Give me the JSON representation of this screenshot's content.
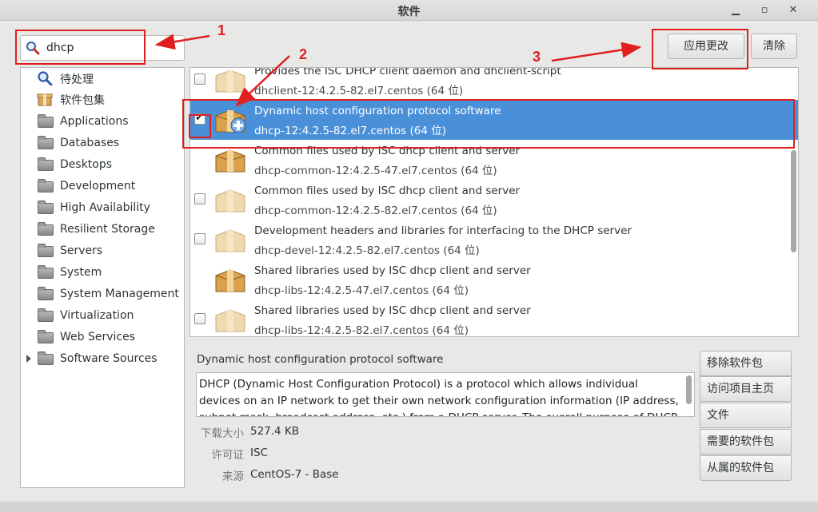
{
  "window": {
    "title": "软件"
  },
  "search": {
    "value": "dhcp"
  },
  "toolbar": {
    "apply_label": "应用更改",
    "clear_label": "清除"
  },
  "sidebar": {
    "top_items": [
      {
        "label": "待处理",
        "icon": "magnifier-icon"
      },
      {
        "label": "软件包集",
        "icon": "package-group-icon"
      }
    ],
    "groups": [
      {
        "label": "Applications"
      },
      {
        "label": "Databases"
      },
      {
        "label": "Desktops"
      },
      {
        "label": "Development"
      },
      {
        "label": "High Availability"
      },
      {
        "label": "Resilient Storage"
      },
      {
        "label": "Servers"
      },
      {
        "label": "System"
      },
      {
        "label": "System Management"
      },
      {
        "label": "Virtualization"
      },
      {
        "label": "Web Services"
      },
      {
        "label": "Software Sources"
      }
    ]
  },
  "packages": [
    {
      "summary": "Provides the ISC DHCP client daemon and dhclient-script",
      "name": "dhclient-12:4.2.5-82.el7.centos (64 位)",
      "checked": false,
      "selected": false
    },
    {
      "summary": "Dynamic host configuration protocol software",
      "name": "dhcp-12:4.2.5-82.el7.centos (64 位)",
      "checked": true,
      "selected": true
    },
    {
      "summary": "Common files used by ISC dhcp client and server",
      "name": "dhcp-common-12:4.2.5-47.el7.centos (64 位)",
      "checked": false,
      "selected": false
    },
    {
      "summary": "Common files used by ISC dhcp client and server",
      "name": "dhcp-common-12:4.2.5-82.el7.centos (64 位)",
      "checked": false,
      "selected": false
    },
    {
      "summary": "Development headers and libraries for interfacing to the DHCP server",
      "name": "dhcp-devel-12:4.2.5-82.el7.centos (64 位)",
      "checked": false,
      "selected": false
    },
    {
      "summary": "Shared libraries used by ISC dhcp client and server",
      "name": "dhcp-libs-12:4.2.5-47.el7.centos (64 位)",
      "checked": false,
      "selected": false
    },
    {
      "summary": "Shared libraries used by ISC dhcp client and server",
      "name": "dhcp-libs-12:4.2.5-82.el7.centos (64 位)",
      "checked": false,
      "selected": false
    }
  ],
  "details": {
    "title": "Dynamic host configuration protocol software",
    "description": "DHCP (Dynamic Host Configuration Protocol) is a protocol which allows individual devices on an IP network to get their own network configuration information (IP address, subnet mask, broadcast address, etc.) from a DHCP server. The overall purpose of DHCP is",
    "download_size_label": "下载大小",
    "download_size": "527.4 KB",
    "license_label": "许可证",
    "license": "ISC",
    "source_label": "来源",
    "source": "CentOS-7 - Base"
  },
  "actions": {
    "remove": "移除软件包",
    "homepage": "访问项目主页",
    "files": "文件",
    "requires": "需要的软件包",
    "depends": "从属的软件包"
  },
  "annotations": {
    "n1": "1",
    "n2": "2",
    "n3": "3"
  },
  "colors": {
    "selection": "#4a90d9",
    "annotation": "#e02020"
  }
}
